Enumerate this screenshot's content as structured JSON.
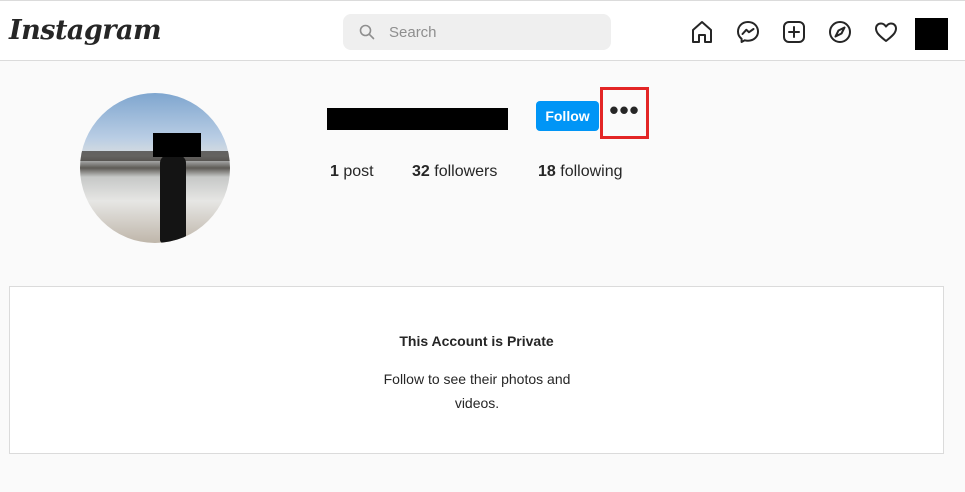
{
  "header": {
    "logo_text": "Instagram",
    "search_placeholder": "Search",
    "icons": [
      "home-icon",
      "messenger-icon",
      "new-post-icon",
      "explore-icon",
      "activity-heart-icon",
      "profile-avatar"
    ]
  },
  "profile": {
    "follow_label": "Follow",
    "more_label": "•••",
    "stats": [
      {
        "count": "1",
        "label": "post"
      },
      {
        "count": "32",
        "label": "followers"
      },
      {
        "count": "18",
        "label": "following"
      }
    ]
  },
  "private_notice": {
    "title": "This Account is Private",
    "message": "Follow to see their photos and videos."
  },
  "colors": {
    "follow_button": "#0095f6",
    "highlight_box": "#e32525",
    "page_background": "#fafafa"
  }
}
